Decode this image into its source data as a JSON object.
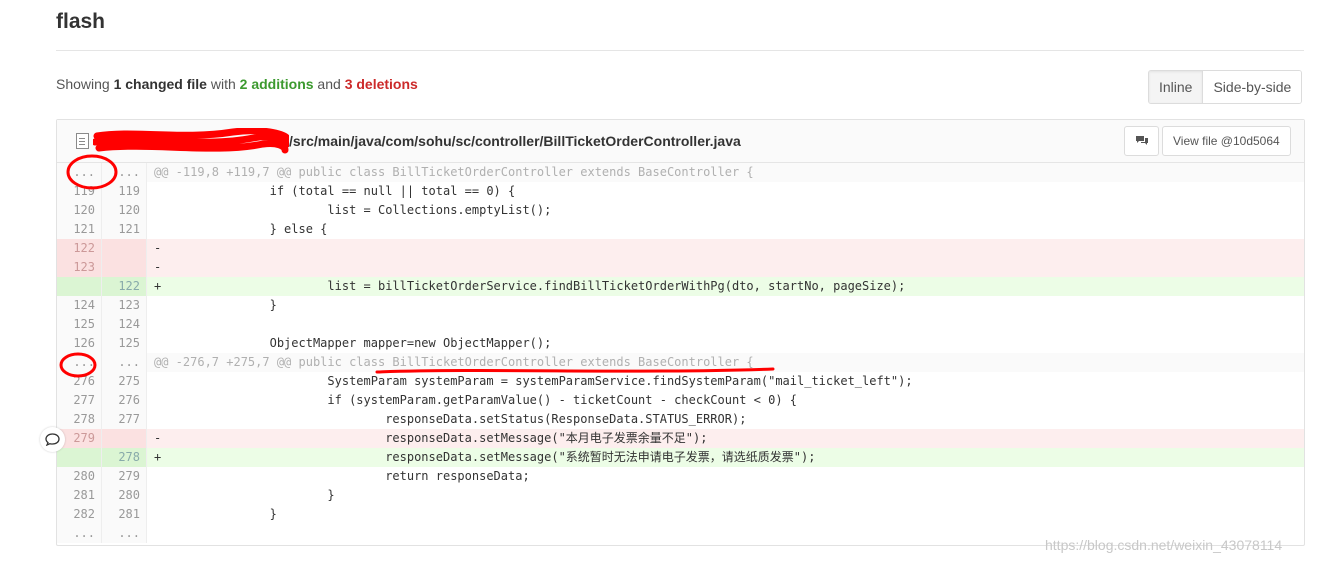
{
  "page": {
    "title": "flash"
  },
  "summary": {
    "prefix": "Showing ",
    "changed": "1 changed file",
    "with": " with ",
    "additions": "2 additions",
    "and": " and ",
    "deletions": "3 deletions"
  },
  "view_toggle": {
    "inline": "Inline",
    "side_by_side": "Side-by-side",
    "active": "inline"
  },
  "file": {
    "path": "/src/main/java/com/sohu/sc/controller/BillTicketOrderController.java",
    "view_file_label": "View file @10d5064",
    "icons": {
      "file": "file-icon",
      "comment": "comment-icon"
    }
  },
  "diff_lines": [
    {
      "type": "match",
      "old": "...",
      "new": "...",
      "code": "@@ -119,8 +119,7 @@ public class BillTicketOrderController extends BaseController {"
    },
    {
      "type": "ctx",
      "old": "119",
      "new": "119",
      "code": "                if (total == null || total == 0) {"
    },
    {
      "type": "ctx",
      "old": "120",
      "new": "120",
      "code": "                        list = Collections.emptyList();"
    },
    {
      "type": "ctx",
      "old": "121",
      "new": "121",
      "code": "                } else {"
    },
    {
      "type": "del",
      "old": "122",
      "new": "",
      "code": "-"
    },
    {
      "type": "del",
      "old": "123",
      "new": "",
      "code": "-"
    },
    {
      "type": "add",
      "old": "",
      "new": "122",
      "code": "+                       list = billTicketOrderService.findBillTicketOrderWithPg(dto, startNo, pageSize);"
    },
    {
      "type": "ctx",
      "old": "124",
      "new": "123",
      "code": "                }"
    },
    {
      "type": "ctx",
      "old": "125",
      "new": "124",
      "code": ""
    },
    {
      "type": "ctx",
      "old": "126",
      "new": "125",
      "code": "                ObjectMapper mapper=new ObjectMapper();"
    },
    {
      "type": "match",
      "old": "...",
      "new": "...",
      "code": "@@ -276,7 +275,7 @@ public class BillTicketOrderController extends BaseController {"
    },
    {
      "type": "ctx",
      "old": "276",
      "new": "275",
      "code": "                        SystemParam systemParam = systemParamService.findSystemParam(\"mail_ticket_left\");"
    },
    {
      "type": "ctx",
      "old": "277",
      "new": "276",
      "code": "                        if (systemParam.getParamValue() - ticketCount - checkCount < 0) {"
    },
    {
      "type": "ctx",
      "old": "278",
      "new": "277",
      "code": "                                responseData.setStatus(ResponseData.STATUS_ERROR);"
    },
    {
      "type": "del",
      "old": "279",
      "new": "",
      "code": "-                               responseData.setMessage(\"本月电子发票余量不足\");"
    },
    {
      "type": "add",
      "old": "",
      "new": "278",
      "code": "+                               responseData.setMessage(\"系统暂时无法申请电子发票，请选纸质发票\");"
    },
    {
      "type": "ctx",
      "old": "280",
      "new": "279",
      "code": "                                return responseData;"
    },
    {
      "type": "ctx",
      "old": "281",
      "new": "280",
      "code": "                        }"
    },
    {
      "type": "ctx",
      "old": "282",
      "new": "281",
      "code": "                }"
    },
    {
      "type": "ctx",
      "old": "...",
      "new": "...",
      "code": ""
    }
  ],
  "watermark": "https://blog.csdn.net/weixin_43078114",
  "colors": {
    "annotation_red": "#ff0000",
    "addition_green": "#3c9a2f",
    "deletion_red": "#cc2a2a"
  }
}
